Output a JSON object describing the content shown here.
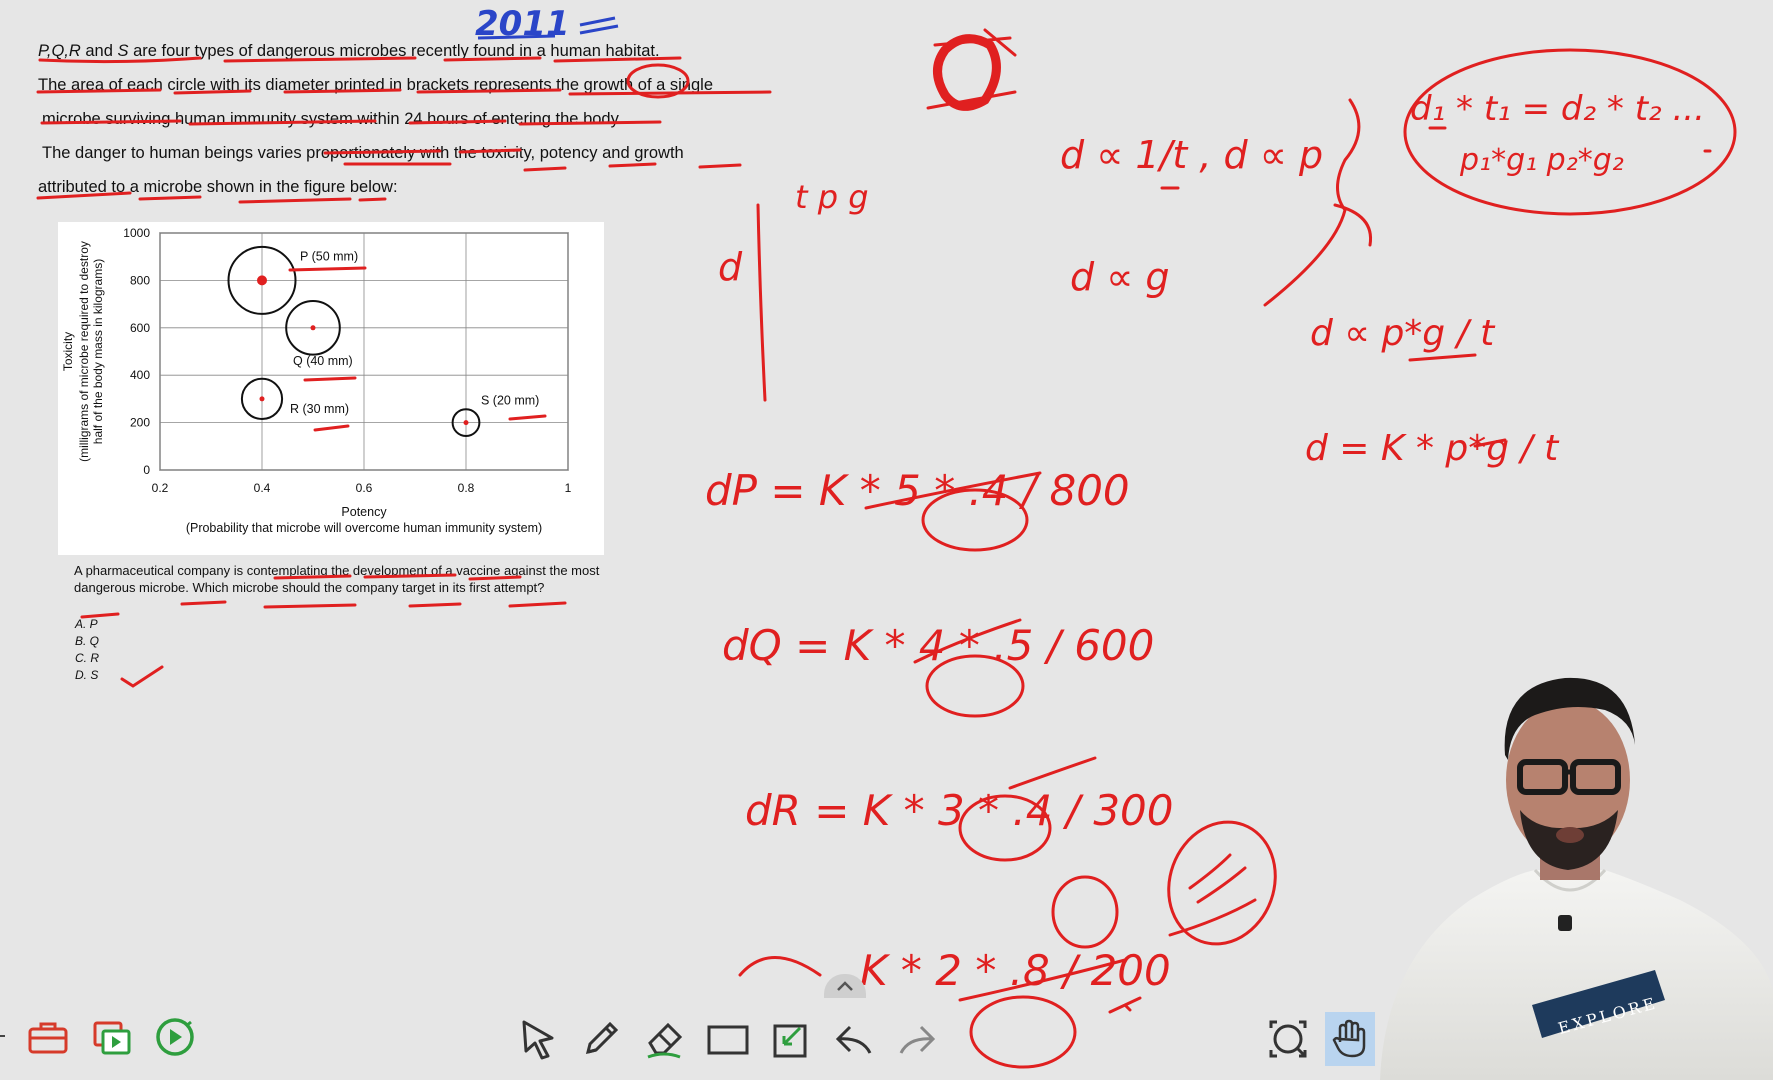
{
  "question": {
    "line1_vars": "P,Q,R",
    "line1_and": " and ",
    "line1_s": "S",
    "line1_rest": " are four types of dangerous microbes recently found in a human habitat.",
    "line2": "The area of each circle with its diameter printed in brackets represents the growth of a single",
    "line3": "microbe surviving human immunity system within 24 hours of entering the body.",
    "line4": "The danger to human beings varies proportionately with the toxicity, potency and growth",
    "line5": "attributed to a microbe shown in the figure below:"
  },
  "chart_data": {
    "type": "scatter",
    "xlabel": "Potency",
    "xlabel_sub": "(Probability that microbe will overcome human immunity system)",
    "ylabel": "Toxicity",
    "ylabel_sub1": "(milligrams of microbe required to destroy",
    "ylabel_sub2": "half of the body mass in kilograms)",
    "xlim": [
      0.2,
      1
    ],
    "ylim": [
      0,
      1000
    ],
    "xticks": [
      "0.2",
      "0.4",
      "0.6",
      "0.8",
      "1"
    ],
    "yticks": [
      "0",
      "200",
      "400",
      "600",
      "800",
      "1000"
    ],
    "grid": true,
    "points": [
      {
        "label": "P (50 mm)",
        "x": 0.4,
        "y": 800,
        "diameter_mm": 50
      },
      {
        "label": "Q (40 mm)",
        "x": 0.5,
        "y": 600,
        "diameter_mm": 40
      },
      {
        "label": "R (30 mm)",
        "x": 0.4,
        "y": 300,
        "diameter_mm": 30
      },
      {
        "label": "S (20 mm)",
        "x": 0.8,
        "y": 200,
        "diameter_mm": 20
      }
    ]
  },
  "subquestion": {
    "text": "A pharmaceutical company is contemplating the development of a vaccine against the most dangerous microbe. Which microbe should the company target in its first attempt?",
    "options": [
      "A. P",
      "B. Q",
      "C. R",
      "D. S"
    ]
  },
  "annotations": {
    "year": "2011",
    "d_prop_1_over_t": "d ∝ 1/t , d ∝ p",
    "d_prop_g": "d ∝ g",
    "boxed_ratio_top": "d₁ * t₁ = d₂ * t₂ ...",
    "boxed_ratio_bottom": "p₁*g₁   p₂*g₂",
    "d_prop_pg_t": "d ∝ p*g / t",
    "d_eq": "d = K * p*g / t",
    "axis_head": "t  p  g",
    "axis_d": "d",
    "dp": "dP = K * 5 * .4 / 800",
    "dq": "dQ = K * 4 * .5 / 600",
    "dr": "dR = K * 3 * .4 / 300",
    "ds": "K * 2 * .8 / 200"
  },
  "colors": {
    "ink_red": "#e02020",
    "ink_blue": "#2a45c8",
    "background": "#e6e6e6",
    "toolbar_red": "#d63a2a",
    "toolbar_green": "#2e9e3e"
  },
  "toolbar": {
    "left_icons": [
      "toolbox-icon",
      "media-icon",
      "play-icon"
    ],
    "mid_icons": [
      "pointer-icon",
      "pen-icon",
      "eraser-icon",
      "rectangle-icon",
      "check-box-icon",
      "undo-icon",
      "redo-icon"
    ],
    "right_icons": [
      "zoom-fit-icon",
      "hand-icon"
    ]
  },
  "presenter": {
    "shirt_text": "EXPLORE"
  }
}
